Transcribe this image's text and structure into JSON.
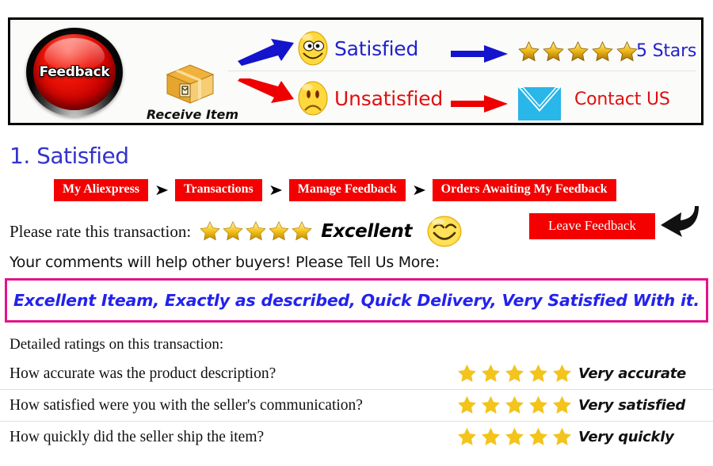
{
  "banner": {
    "feedback_button_label": "Feedback",
    "receive_item_label": "Receive Item",
    "satisfied_label": "Satisfied",
    "unsatisfied_label": "Unsatisfied",
    "five_stars_label": "5 Stars",
    "contact_us_label": "Contact US",
    "satisfied_color": "#2222cc",
    "unsatisfied_color": "#e01010",
    "satisfied_arrow_color": "#1414cc",
    "unsatisfied_arrow_color": "#ee0000",
    "envelope_color": "#29b6e8",
    "star_count": 5,
    "icons": {
      "feedback": "red-glossy-button-icon",
      "package": "package-box-icon",
      "happy": "smiley-happy-icon",
      "sad": "smiley-sad-icon",
      "envelope": "envelope-icon"
    }
  },
  "section": {
    "title": "1. Satisfied"
  },
  "breadcrumb": {
    "separator": "➤",
    "items": [
      {
        "label": "My Aliexpress"
      },
      {
        "label": "Transactions"
      },
      {
        "label": "Manage Feedback"
      },
      {
        "label": "Orders Awaiting My Feedback"
      }
    ],
    "chip_bg": "#f50000",
    "chip_fg": "#ffffff"
  },
  "rate": {
    "label": "Please rate this transaction:",
    "stars_filled": 5,
    "stars_total": 5,
    "rating_word": "Excellent",
    "leave_feedback_label": "Leave Feedback"
  },
  "comments": {
    "prompt": "Your comments will help other buyers! Please Tell Us More:",
    "text": "Excellent Iteam, Exactly as described, Quick Delivery, Very Satisfied With it.",
    "text_color": "#2222ee",
    "border_color": "#e3138c"
  },
  "detailed": {
    "title": "Detailed ratings on this transaction:",
    "star_color": "#f2c41c",
    "rows": [
      {
        "question": "How accurate was the product description?",
        "stars": 5,
        "value": "Very accurate"
      },
      {
        "question": "How satisfied were you with the seller's communication?",
        "stars": 5,
        "value": "Very satisfied"
      },
      {
        "question": "How quickly did the seller ship the item?",
        "stars": 5,
        "value": "Very quickly"
      }
    ]
  }
}
